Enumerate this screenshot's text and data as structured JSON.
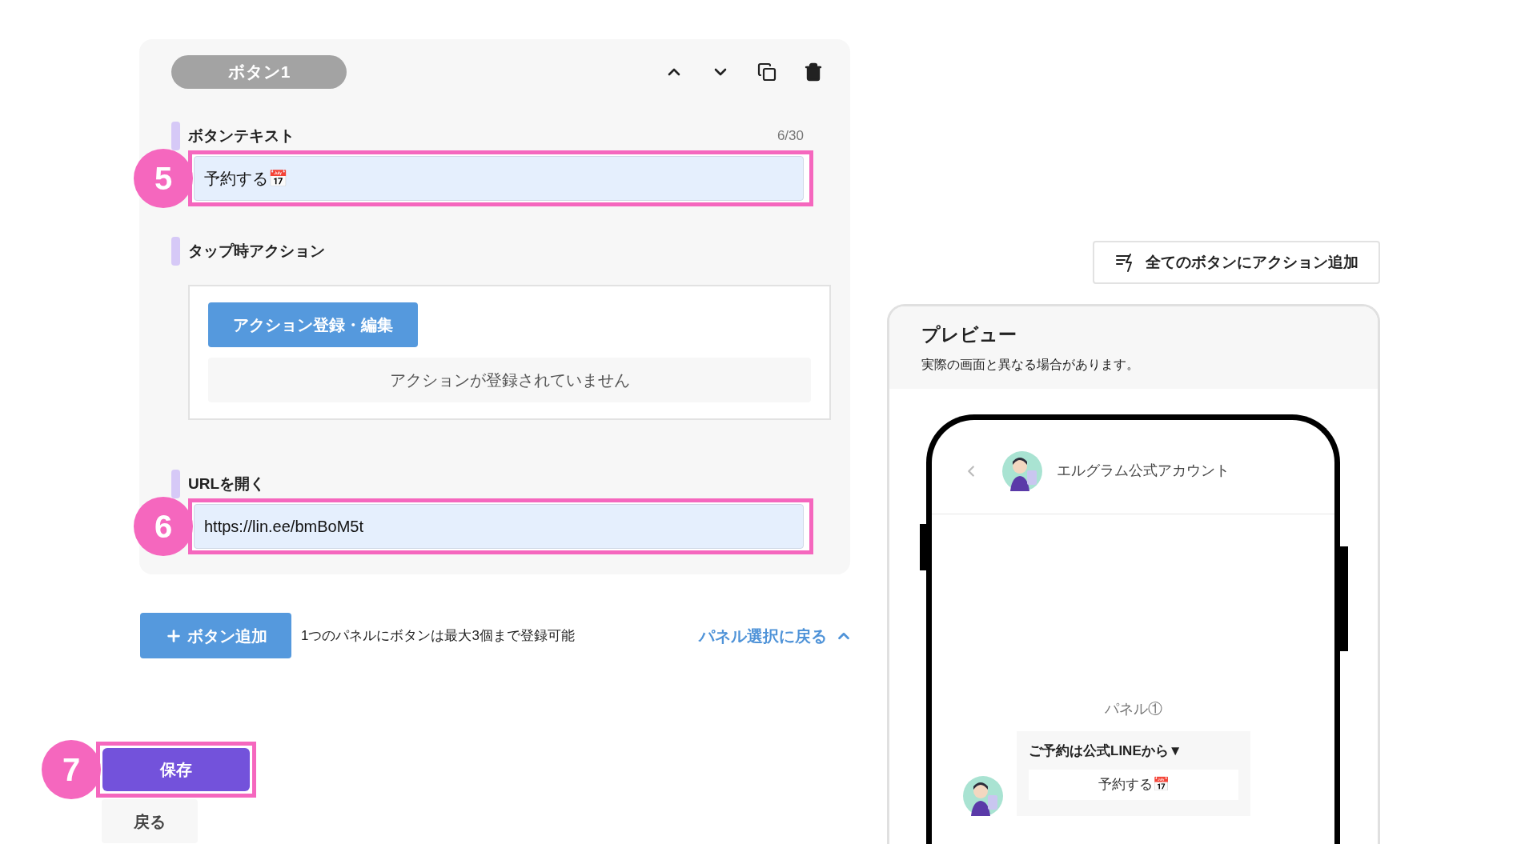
{
  "editor": {
    "badge": "ボタン1",
    "button_text": {
      "label": "ボタンテキスト",
      "counter": "6/30",
      "value": "予約する📅",
      "marker": "5"
    },
    "tap_action": {
      "label": "タップ時アクション",
      "button": "アクション登録・編集",
      "empty_message": "アクションが登録されていません"
    },
    "open_url": {
      "label": "URLを開く",
      "value": "https://lin.ee/bmBoM5t",
      "marker": "6"
    }
  },
  "add_button": "ボタン追加",
  "limit_note": "1つのパネルにボタンは最大3個まで登録可能",
  "back_to_panels": "パネル選択に戻る",
  "save": {
    "label": "保存",
    "marker": "7"
  },
  "back": "戻る",
  "add_action_all": "全てのボタンにアクション追加",
  "preview": {
    "title": "プレビュー",
    "note": "実際の画面と異なる場合があります。",
    "account": "エルグラム公式アカウント",
    "panel_label": "パネル①",
    "message": "ご予約は公式LINEから▼",
    "message_button": "予約する📅"
  }
}
